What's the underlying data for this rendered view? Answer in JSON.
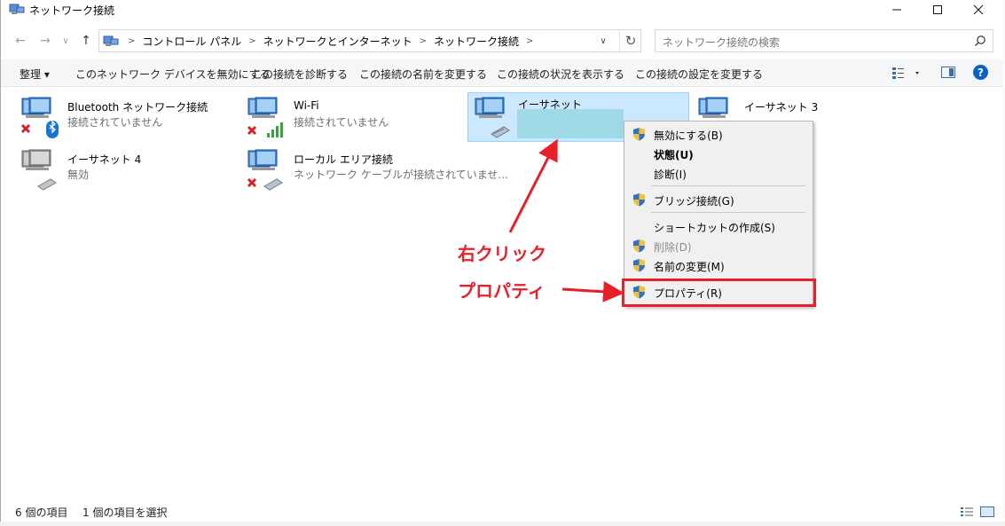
{
  "window": {
    "title": "ネットワーク接続"
  },
  "address": {
    "crumbs": [
      "コントロール パネル",
      "ネットワークとインターネット",
      "ネットワーク接続"
    ],
    "search_placeholder": "ネットワーク接続の検索"
  },
  "commands": {
    "organize": "整理 ▾",
    "disable": "このネットワーク デバイスを無効にする",
    "diagnose": "この接続を診断する",
    "rename": "この接続の名前を変更する",
    "status": "この接続の状況を表示する",
    "settings": "この接続の設定を変更する"
  },
  "items": [
    {
      "name": "Bluetooth ネットワーク接続",
      "status": "接続されていません"
    },
    {
      "name": "Wi-Fi",
      "status": "接続されていません"
    },
    {
      "name": "イーサネット",
      "status": ""
    },
    {
      "name": "イーサネット 3",
      "status": ""
    },
    {
      "name": "イーサネット 4",
      "status": "無効"
    },
    {
      "name": "ローカル エリア接続",
      "status": "ネットワーク ケーブルが接続されていませ..."
    }
  ],
  "context_menu": [
    {
      "label": "無効にする(B)"
    },
    {
      "label": "状態(U)"
    },
    {
      "label": "診断(I)"
    },
    {
      "label": "ブリッジ接続(G)"
    },
    {
      "label": "ショートカットの作成(S)"
    },
    {
      "label": "削除(D)"
    },
    {
      "label": "名前の変更(M)"
    },
    {
      "label": "プロパティ(R)"
    }
  ],
  "annotations": {
    "right_click": "右クリック",
    "properties": "プロパティ"
  },
  "statusbar": {
    "count": "6 個の項目",
    "selected": "1 個の項目を選択"
  },
  "colors": {
    "accent": "#0a63c4",
    "annotation": "#e8202a",
    "selection": "#cce8ff"
  }
}
